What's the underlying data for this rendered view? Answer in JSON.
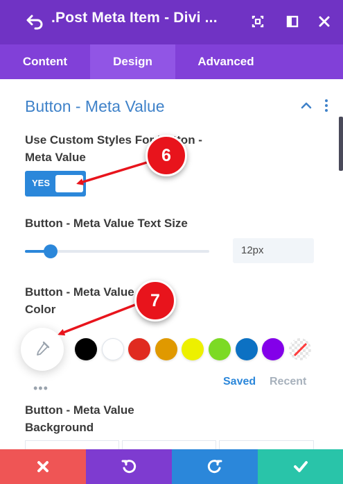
{
  "header": {
    "title": ".Post Meta Item - Divi ...",
    "bg_color": "#7033c4",
    "icons": [
      "undo-arrow-icon",
      "focus-icon",
      "columns-icon",
      "close-icon"
    ]
  },
  "tabs": [
    {
      "label": "Content",
      "active": false
    },
    {
      "label": "Design",
      "active": true
    },
    {
      "label": "Advanced",
      "active": false
    }
  ],
  "section": {
    "title": "Button - Meta Value",
    "accent_color": "#3f82c9"
  },
  "custom_styles": {
    "label": "Use Custom Styles For Button - Meta Value",
    "toggle_label": "YES",
    "enabled": true
  },
  "text_size": {
    "label": "Button - Meta Value Text Size",
    "value": "12px",
    "slider_fraction": 0.14
  },
  "color": {
    "label": "Button - Meta Value Color",
    "swatches": [
      "#000000",
      "#ffffff",
      "#e02b20",
      "#e09900",
      "#edf000",
      "#7cda24",
      "#0c71c3",
      "#8300e9",
      "transparent"
    ],
    "saved_label": "Saved",
    "recent_label": "Recent",
    "more_label": "•••"
  },
  "background": {
    "label": "Button - Meta Value Background"
  },
  "annotations": [
    {
      "number": "6"
    },
    {
      "number": "7"
    }
  ],
  "footer": {
    "buttons": [
      {
        "name": "cancel",
        "color": "#ef5555"
      },
      {
        "name": "undo",
        "color": "#7e3bd0"
      },
      {
        "name": "redo",
        "color": "#2b87da"
      },
      {
        "name": "save",
        "color": "#29c4a9"
      }
    ]
  }
}
